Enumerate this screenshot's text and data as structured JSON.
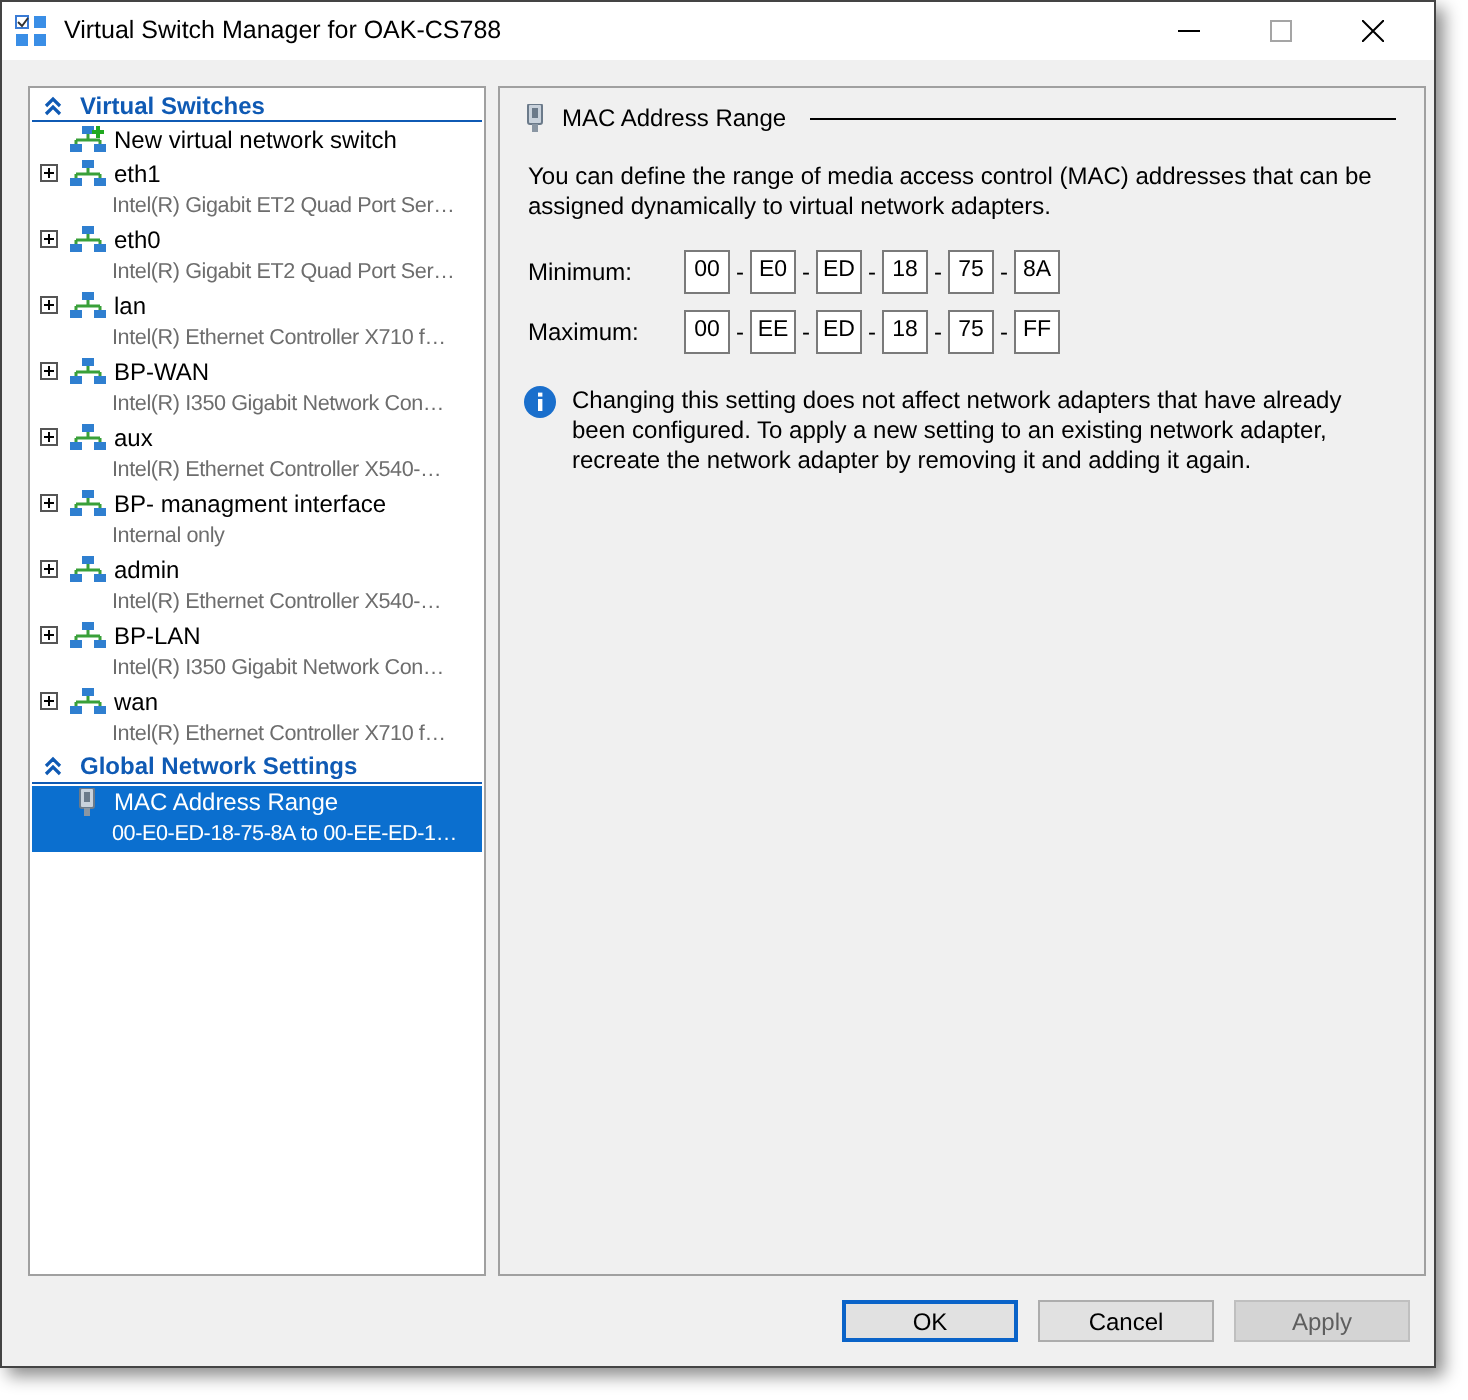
{
  "window": {
    "title": "Virtual Switch Manager for OAK-CS788",
    "maximize_disabled": true
  },
  "tree": [
    {
      "title": "Virtual Switches",
      "expanded": true,
      "items": [
        {
          "kind": "new",
          "label": "New virtual network switch",
          "selected": false
        },
        {
          "kind": "switch",
          "label": "eth1",
          "detail": "Intel(R) Gigabit ET2 Quad Port Ser…",
          "expanded": false,
          "selected": false
        },
        {
          "kind": "switch",
          "label": "eth0",
          "detail": "Intel(R) Gigabit ET2 Quad Port Ser…",
          "expanded": false,
          "selected": false
        },
        {
          "kind": "switch",
          "label": "lan",
          "detail": "Intel(R) Ethernet Controller X710 f…",
          "expanded": false,
          "selected": false
        },
        {
          "kind": "switch",
          "label": "BP-WAN",
          "detail": "Intel(R) I350 Gigabit Network Con…",
          "expanded": false,
          "selected": false
        },
        {
          "kind": "switch",
          "label": "aux",
          "detail": "Intel(R) Ethernet Controller X540-…",
          "expanded": false,
          "selected": false
        },
        {
          "kind": "switch",
          "label": "BP- managment interface",
          "detail": "Internal only",
          "expanded": false,
          "selected": false
        },
        {
          "kind": "switch",
          "label": "admin",
          "detail": "Intel(R) Ethernet Controller X540-…",
          "expanded": false,
          "selected": false
        },
        {
          "kind": "switch",
          "label": "BP-LAN",
          "detail": "Intel(R) I350 Gigabit Network Con…",
          "expanded": false,
          "selected": false
        },
        {
          "kind": "switch",
          "label": "wan",
          "detail": "Intel(R) Ethernet Controller X710 f…",
          "expanded": false,
          "selected": false
        }
      ]
    },
    {
      "title": "Global Network Settings",
      "expanded": true,
      "items": [
        {
          "kind": "setting",
          "label": "MAC Address Range",
          "detail": "00-E0-ED-18-75-8A to 00-EE-ED-1…",
          "selected": true
        }
      ]
    }
  ],
  "panel": {
    "title": "MAC Address Range",
    "description": "You can define the range of media access control (MAC) addresses that can be assigned dynamically to virtual network adapters.",
    "fields": [
      {
        "label": "Minimum:",
        "octets": [
          "00",
          "E0",
          "ED",
          "18",
          "75",
          "8A"
        ],
        "separators": [
          "-",
          "-",
          "-",
          "-",
          "-"
        ]
      },
      {
        "label": "Maximum:",
        "octets": [
          "00",
          "EE",
          "ED",
          "18",
          "75",
          "FF"
        ],
        "separators": [
          "-",
          "-",
          "-",
          "-",
          "-"
        ]
      }
    ],
    "note": "Changing this setting does not affect network adapters that have already been configured.  To apply a new setting to an existing network adapter, recreate the network adapter by removing it and adding it again."
  },
  "buttons": [
    {
      "label": "OK",
      "default": true,
      "disabled": false
    },
    {
      "label": "Cancel",
      "default": false,
      "disabled": false
    },
    {
      "label": "Apply",
      "default": false,
      "disabled": true
    }
  ]
}
